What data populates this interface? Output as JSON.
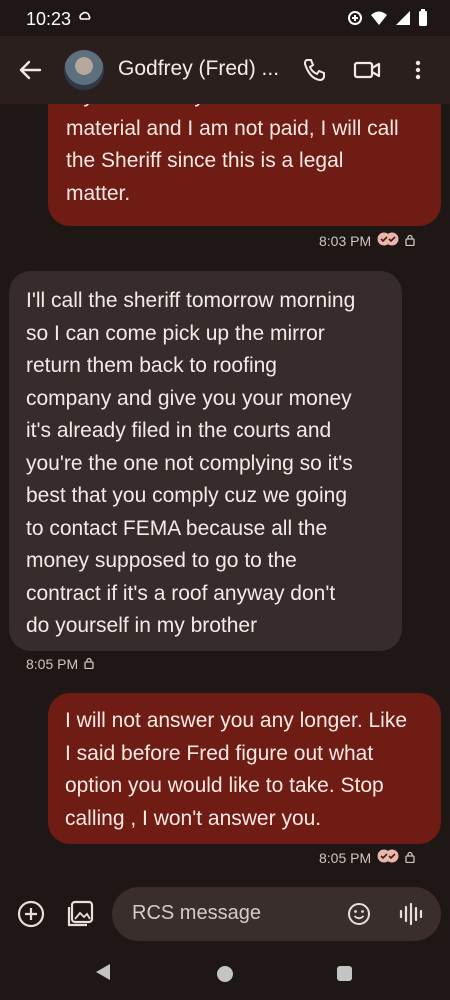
{
  "status_bar": {
    "time": "10:23"
  },
  "header": {
    "contact_name": "Godfrey (Fred) ..."
  },
  "messages": [
    {
      "direction": "outgoing",
      "text": "my home to try to remove the\nmaterial and I am not paid, I will call\nthe Sheriff since  this is a legal\nmatter.",
      "time": "8:03 PM"
    },
    {
      "direction": "incoming",
      "text": "I'll call the sheriff tomorrow morning\nso I can come pick up the mirror\nreturn them back to roofing\ncompany and give you your money\nit's already filed in the courts and\nyou're the one not complying so it's\nbest that you comply cuz we going\nto contact FEMA because all the\nmoney supposed to go to the\ncontract if it's a roof anyway don't\ndo yourself in my brother",
      "time": "8:05 PM"
    },
    {
      "direction": "outgoing",
      "text": "I will not answer you any longer. Like\nI said before Fred figure out what\noption you would like to take. Stop\ncalling , I won't answer you.",
      "time": "8:05 PM"
    }
  ],
  "composer": {
    "placeholder": "RCS message"
  },
  "colors": {
    "outgoing_bubble": "#6e1c14",
    "incoming_bubble": "#362c2b",
    "background": "#1f1716"
  }
}
